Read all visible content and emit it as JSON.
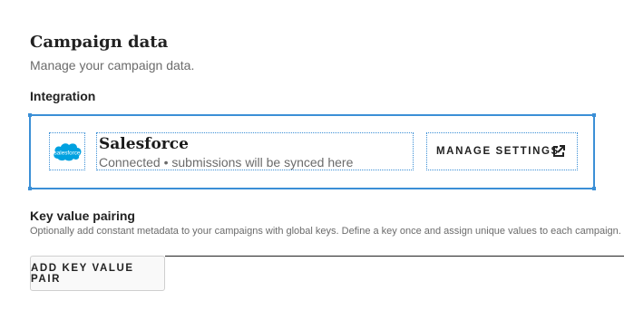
{
  "page": {
    "title": "Campaign data",
    "subtitle": "Manage your campaign data."
  },
  "integration": {
    "heading": "Integration",
    "provider": {
      "logo_text": "salesforce",
      "logo_color": "#00A1E0",
      "name": "Salesforce",
      "status": "Connected • submissions will be synced here"
    },
    "manage_button_label": "MANAGE SETTINGS",
    "manage_button_icon": "external-link-icon",
    "accent_color": "#3b8fd6"
  },
  "key_value": {
    "heading": "Key value pairing",
    "description": "Optionally add constant metadata to your campaigns with global keys. Define a key once and assign unique values to each campaign.",
    "add_button_label": "ADD KEY VALUE PAIR"
  }
}
